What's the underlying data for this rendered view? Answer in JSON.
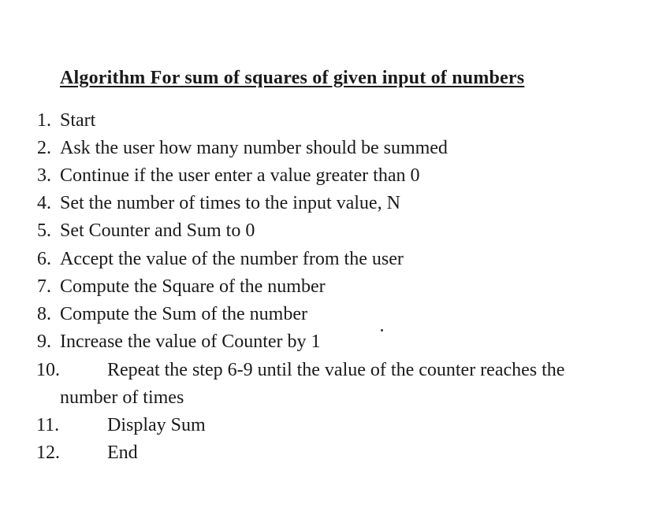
{
  "title": "Algorithm For sum of squares of given input of numbers",
  "steps": [
    {
      "number": "1.",
      "text": "Start"
    },
    {
      "number": "2.",
      "text": "Ask the user how many number should be summed"
    },
    {
      "number": "3.",
      "text": "Continue if the user enter a value greater than 0"
    },
    {
      "number": "4.",
      "text": "Set the number of times to the input value, N"
    },
    {
      "number": "5.",
      "text": "Set Counter and Sum to 0"
    },
    {
      "number": "6.",
      "text": "Accept the value of the number from the user"
    },
    {
      "number": "7.",
      "text": "Compute the Square of the number"
    },
    {
      "number": "8.",
      "text": "Compute the Sum of the number"
    },
    {
      "number": "9.",
      "text": "Increase the value of Counter by 1"
    },
    {
      "number": "10.",
      "text": "Repeat the step 6-9 until the value of the counter reaches the",
      "continuation": "number of times"
    },
    {
      "number": "11.",
      "text": "Display Sum"
    },
    {
      "number": "12.",
      "text": "End"
    }
  ]
}
